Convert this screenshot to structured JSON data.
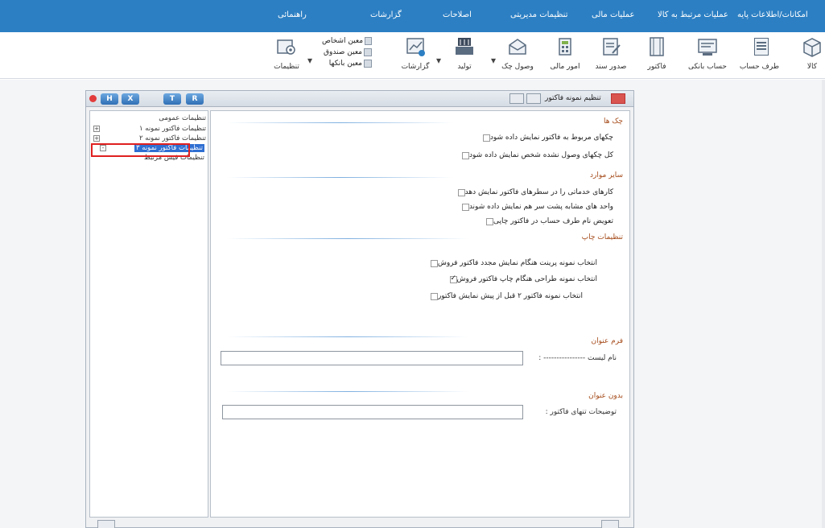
{
  "menubar": {
    "items": [
      "امکانات/اطلاعات پایه",
      "عملیات مرتبط به کالا",
      "عملیات مالی",
      "تنظیمات مدیریتی",
      "اصلاحات",
      "گزارشات",
      "راهنمائی"
    ]
  },
  "ribbon": {
    "buttons": [
      {
        "label": "کالا",
        "icon": "box-icon"
      },
      {
        "label": "طرف حساب",
        "icon": "contact-card-icon"
      },
      {
        "label": "حساب بانکی",
        "icon": "bank-account-icon"
      },
      {
        "label": "فاکتور",
        "icon": "invoice-icon"
      },
      {
        "label": "صدور سند",
        "icon": "document-issue-icon"
      },
      {
        "label": "امور مالی",
        "icon": "finance-icon"
      },
      {
        "label": "وصول چک",
        "icon": "check-receive-icon"
      },
      {
        "label": "تولید",
        "icon": "production-icon"
      },
      {
        "label": "گزارشات",
        "icon": "chart-report-icon"
      },
      {
        "label": "تنظیمات",
        "icon": "settings-icon"
      }
    ],
    "small_items": [
      "معین اشخاص",
      "معین صندوق",
      "معین بانکها"
    ]
  },
  "dialog": {
    "title": "تنظیم نمونه فاکتور",
    "tab_buttons": [
      "H",
      "X",
      "T",
      "R"
    ],
    "tree": [
      {
        "label": "تنظیمات عمومی",
        "expander": ""
      },
      {
        "label": "تنظیمات فاکتور نمونه ۱",
        "expander": "+"
      },
      {
        "label": "تنظیمات فاکتور نمونه ۲",
        "expander": "+"
      },
      {
        "label": "تنظیمات فاکتور نمونه ۳",
        "expander": "-"
      },
      {
        "label": "تنظیمات فیش مرتبط",
        "expander": ""
      }
    ],
    "sections": {
      "checks": {
        "title": "چک ها",
        "options": [
          {
            "label": "چکهای مربوط به فاکتور نمایش داده شود",
            "checked": false
          },
          {
            "label": "کل چکهای وصول نشده شخص نمایش داده شود",
            "checked": false
          }
        ]
      },
      "other": {
        "title": "سایر موارد",
        "options": [
          {
            "label": "کارهای خدماتی را در سطرهای فاکتور نمایش دهد",
            "checked": false
          },
          {
            "label": "واحد های مشابه پشت سر هم نمایش داده شوند",
            "checked": false
          },
          {
            "label": "تعویض نام طرف حساب در فاکتور چاپی",
            "checked": false
          }
        ]
      },
      "print": {
        "title": "تنظیمات چاپ",
        "options": [
          {
            "label": "انتخاب نمونه پرینت هنگام نمایش مجدد فاکتور فروش",
            "checked": false
          },
          {
            "label": "انتخاب نمونه طراحی هنگام چاپ فاکتور فروش",
            "checked": true
          },
          {
            "label": "انتخاب نمونه فاکتور ۲ قبل از پیش نمایش فاکتور",
            "checked": false
          }
        ]
      },
      "with_title": {
        "title": "فرم عنوان",
        "field_label": "نام لیست ---------------- :",
        "value": ""
      },
      "without_title": {
        "title": "بدون عنوان",
        "field_label": "توضیحات تنهای فاکتور :",
        "value": ""
      }
    }
  },
  "colors": {
    "menubar": "#2c7fc3",
    "selection": "#2f6fd2",
    "highlight_box": "#e02020",
    "section_title": "#a54b1a"
  }
}
